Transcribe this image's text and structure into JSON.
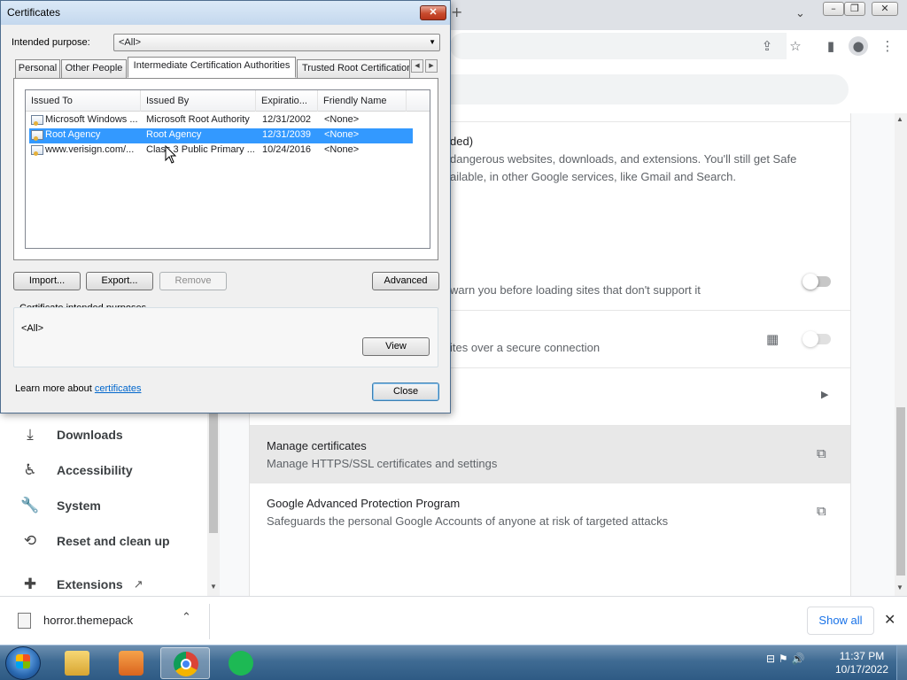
{
  "dialog": {
    "title": "Certificates",
    "close_glyph": "✕",
    "purpose_label": "Intended purpose:",
    "purpose_value": "<All>",
    "tabs": [
      {
        "label": "Personal"
      },
      {
        "label": "Other People"
      },
      {
        "label": "Intermediate Certification Authorities"
      },
      {
        "label": "Trusted Root Certification"
      }
    ],
    "columns": [
      "Issued To",
      "Issued By",
      "Expiratio...",
      "Friendly Name"
    ],
    "rows": [
      {
        "issued_to": "Microsoft Windows ...",
        "issued_by": "Microsoft Root Authority",
        "expiration": "12/31/2002",
        "friendly_name": "<None>",
        "selected": false
      },
      {
        "issued_to": "Root Agency",
        "issued_by": "Root Agency",
        "expiration": "12/31/2039",
        "friendly_name": "<None>",
        "selected": true
      },
      {
        "issued_to": "www.verisign.com/...",
        "issued_by": "Class 3 Public Primary ...",
        "expiration": "10/24/2016",
        "friendly_name": "<None>",
        "selected": false
      }
    ],
    "buttons": {
      "import": "Import...",
      "export": "Export...",
      "remove": "Remove",
      "advanced": "Advanced",
      "view": "View",
      "close": "Close"
    },
    "purposes_group_label": "Certificate intended purposes",
    "purposes_value": "<All>",
    "learn_more_prefix": "Learn more about ",
    "learn_more_link": "certificates"
  },
  "browser": {
    "visible_text": {
      "row1_title_fragment": "ded)",
      "row1_line1": "dangerous websites, downloads, and extensions. You'll still get Safe",
      "row1_line2": "ailable, in other Google services, like Gmail and Search.",
      "row2_text": "warn you before loading sites that don't support it",
      "row3_text": "ites over a secure connection"
    },
    "manage_certs": {
      "title": "Manage certificates",
      "subtitle": "Manage HTTPS/SSL certificates and settings"
    },
    "advanced_protection": {
      "title": "Google Advanced Protection Program",
      "subtitle": "Safeguards the personal Google Accounts of anyone at risk of targeted attacks"
    },
    "sidebar": [
      {
        "label": "Downloads",
        "icon": "download-icon",
        "glyph": "⤓"
      },
      {
        "label": "Accessibility",
        "icon": "accessibility-icon",
        "glyph": "♿"
      },
      {
        "label": "System",
        "icon": "wrench-icon",
        "glyph": "🔧"
      },
      {
        "label": "Reset and clean up",
        "icon": "reset-icon",
        "glyph": "⟲"
      },
      {
        "label": "Extensions",
        "icon": "puzzle-icon",
        "glyph": "✚"
      }
    ]
  },
  "download_bar": {
    "file_name": "horror.themepack",
    "show_all": "Show all"
  },
  "taskbar": {
    "time": "11:37 PM",
    "date": "10/17/2022"
  },
  "colors": {
    "selection": "#3399ff",
    "link": "#0066cc",
    "chrome_blue": "#1a73e8"
  }
}
